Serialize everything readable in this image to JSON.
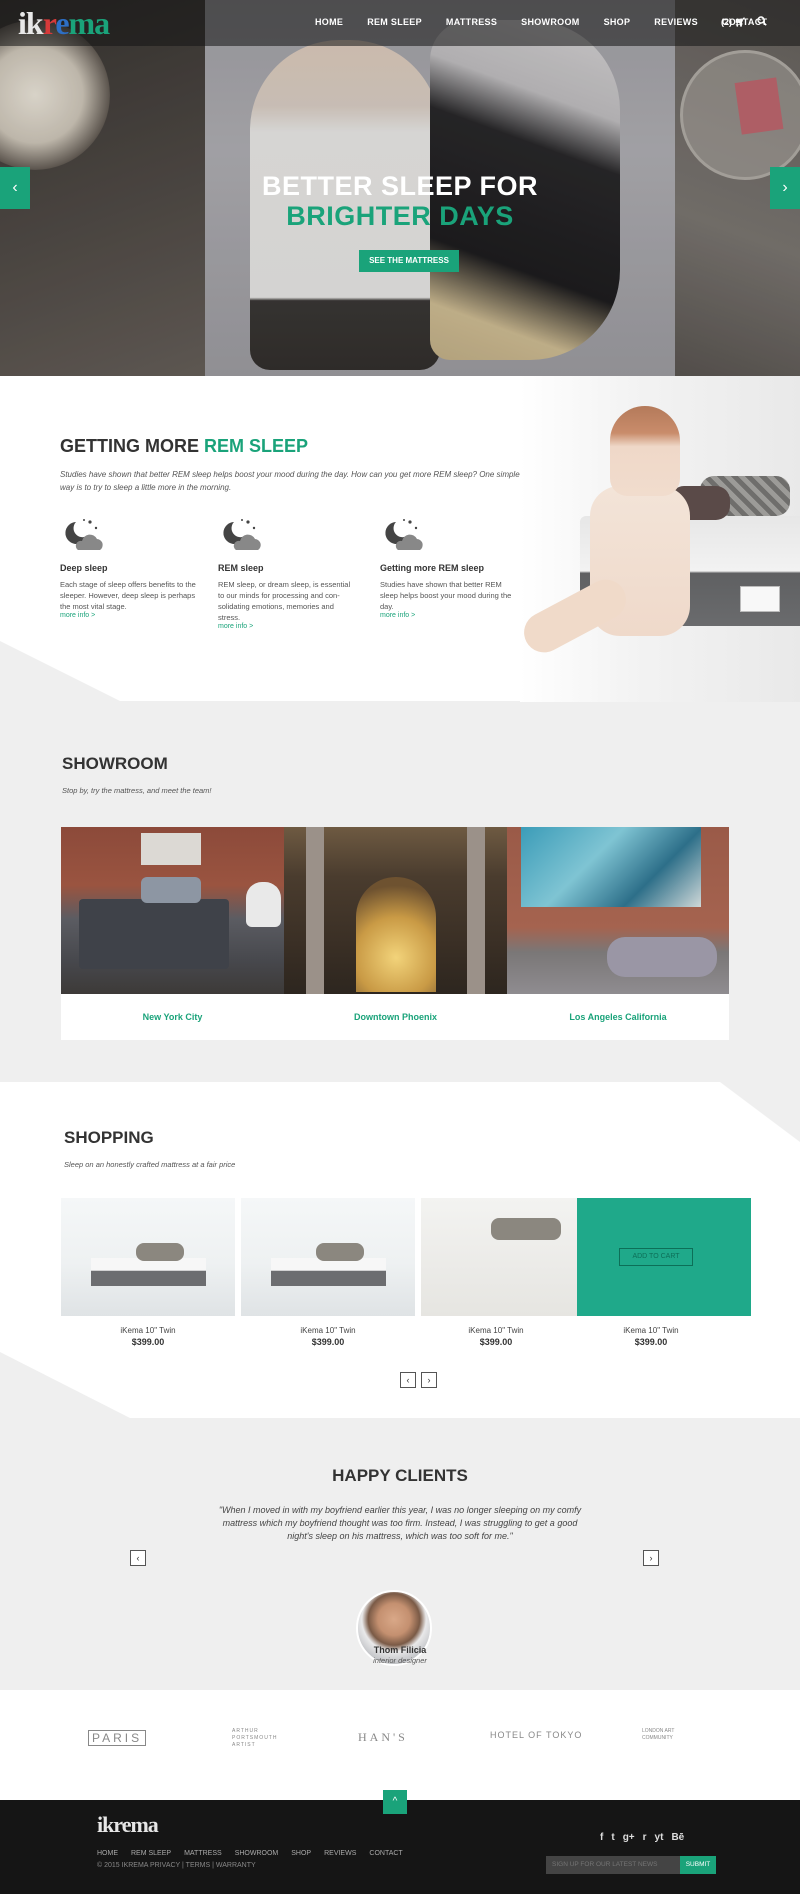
{
  "brand": {
    "logo_text": "ikrema"
  },
  "nav": {
    "items": [
      "HOME",
      "REM SLEEP",
      "MATTRESS",
      "SHOWROOM",
      "SHOP",
      "REVIEWS",
      "CONTACT"
    ],
    "cart_label": "(2)"
  },
  "hero": {
    "title_line1": "BETTER SLEEP FOR",
    "title_line2": "BRIGHTER DAYS",
    "cta_label": "SEE THE MATTRESS",
    "prev_arrow": "‹",
    "next_arrow": "›"
  },
  "rem": {
    "title_plain": "GETTING MORE",
    "title_accent": "REM SLEEP",
    "intro": "Studies have shown that better REM sleep helps boost your mood during the day. How can you get more REM sleep? One simple way is to try to sleep a little more in the morning.",
    "columns": [
      {
        "heading": "Deep sleep",
        "text": "Each stage of sleep offers benefits to the sleeper. However, deep sleep is perhaps the most vital stage.",
        "more": "more info >"
      },
      {
        "heading": "REM sleep",
        "text": "REM sleep, or dream sleep, is essential to our minds for processing and con-solidating emotions, memories and stress.",
        "more": "more info >"
      },
      {
        "heading": "Getting more REM sleep",
        "text": "Studies have shown that better REM sleep helps boost your mood during the day.",
        "more": "more info >"
      }
    ]
  },
  "showroom": {
    "title": "SHOWROOM",
    "subtitle": "Stop by, try the mattress, and meet the team!",
    "locations": [
      "New York City",
      "Downtown Phoenix",
      "Los Angeles California"
    ]
  },
  "shopping": {
    "title": "SHOPPING",
    "subtitle": "Sleep on an honestly crafted mattress at a fair price",
    "products": [
      {
        "name": "iKema 10\" Twin",
        "price": "$399.00"
      },
      {
        "name": "iKema 10\" Twin",
        "price": "$399.00"
      },
      {
        "name": "iKema 10\" Twin",
        "price": "$399.00"
      },
      {
        "name": "iKema 10\" Twin",
        "price": "$399.00"
      }
    ],
    "add_to_cart": "ADD TO CART",
    "prev": "‹",
    "next": "›"
  },
  "clients": {
    "title": "HAPPY CLIENTS",
    "quote": "\"When I moved in with my boyfriend earlier this year, I was no longer sleeping on my comfy mattress which my boyfriend thought was too firm. Instead, I was struggling to get a good night's sleep on his mattress, which was too soft for me.\"",
    "name": "Thom Filicia",
    "role": "interior designer",
    "prev": "‹",
    "next": "›"
  },
  "partners": [
    "PARIS",
    "ARTHUR PORTSMOUTH ARTIST",
    "HAN'S",
    "HOTEL OF TOKYO",
    "LONDON ART COMMUNITY"
  ],
  "footer": {
    "logo_text": "ikrema",
    "nav": [
      "HOME",
      "REM SLEEP",
      "MATTRESS",
      "SHOWROOM",
      "SHOP",
      "REVIEWS",
      "CONTACT"
    ],
    "copyright": "© 2015 IKREMA   PRIVACY | TERMS | WARRANTY",
    "social": [
      "f",
      "t",
      "g+",
      "r",
      "yt",
      "Bē"
    ],
    "newsletter_placeholder": "SIGN UP FOR OUR LATEST NEWS",
    "submit_label": "SUBMIT",
    "back_to_top": "^"
  },
  "colors": {
    "accent": "#1aa37a",
    "dark": "#151515",
    "light_bg": "#efefef"
  }
}
